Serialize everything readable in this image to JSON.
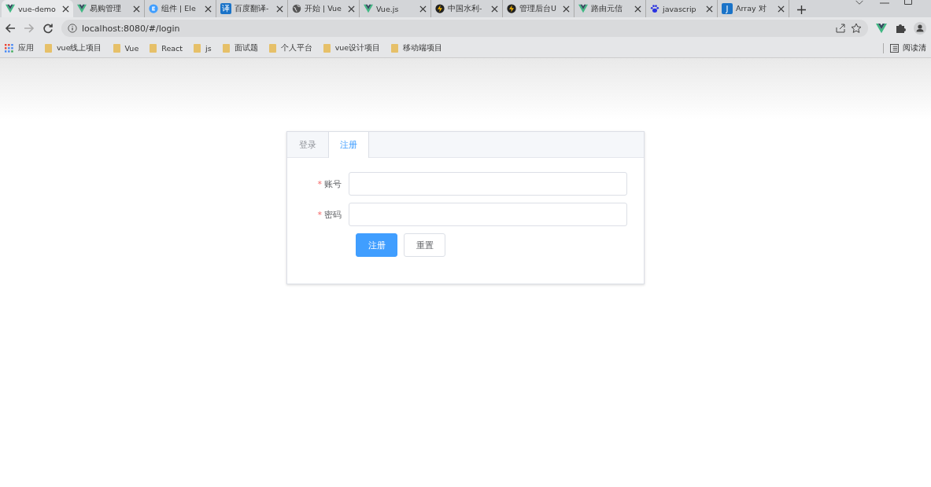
{
  "browser": {
    "tabs": [
      {
        "title": "vue-demo",
        "kind": "vue",
        "selected": true
      },
      {
        "title": "易购管理",
        "kind": "vue",
        "selected": false
      },
      {
        "title": "组件 | Ele",
        "kind": "element",
        "selected": false
      },
      {
        "title": "百度翻译-",
        "kind": "square",
        "glyph": "译",
        "selected": false
      },
      {
        "title": "开始 | Vue",
        "kind": "globe",
        "selected": false
      },
      {
        "title": "Vue.js",
        "kind": "vue",
        "selected": false
      },
      {
        "title": "中国水利-",
        "kind": "bolt",
        "selected": false
      },
      {
        "title": "管理后台U",
        "kind": "bolt",
        "selected": false
      },
      {
        "title": "路由元信",
        "kind": "vue",
        "selected": false
      },
      {
        "title": "javascrip",
        "kind": "paw",
        "selected": false
      },
      {
        "title": "Array 对",
        "kind": "square",
        "glyph": "J",
        "selected": false
      }
    ],
    "address": "localhost:8080/#/login",
    "bookmarks": [
      {
        "label": "应用",
        "kind": "apps"
      },
      {
        "label": "vue线上项目",
        "kind": "folder"
      },
      {
        "label": "Vue",
        "kind": "folder"
      },
      {
        "label": "React",
        "kind": "folder"
      },
      {
        "label": "js",
        "kind": "folder"
      },
      {
        "label": "面试题",
        "kind": "folder"
      },
      {
        "label": "个人平台",
        "kind": "folder"
      },
      {
        "label": "vue设计项目",
        "kind": "folder"
      },
      {
        "label": "移动端项目",
        "kind": "folder"
      }
    ],
    "reading_list": "阅读清"
  },
  "card": {
    "tabs": [
      {
        "label": "登录",
        "selected": false
      },
      {
        "label": "注册",
        "selected": true
      }
    ],
    "fields": [
      {
        "label": "账号",
        "marker": "*"
      },
      {
        "label": "密码",
        "marker": "*"
      }
    ],
    "buttons": [
      {
        "label": "注册",
        "kind": "primary"
      },
      {
        "label": "重置",
        "kind": "default"
      }
    ]
  }
}
